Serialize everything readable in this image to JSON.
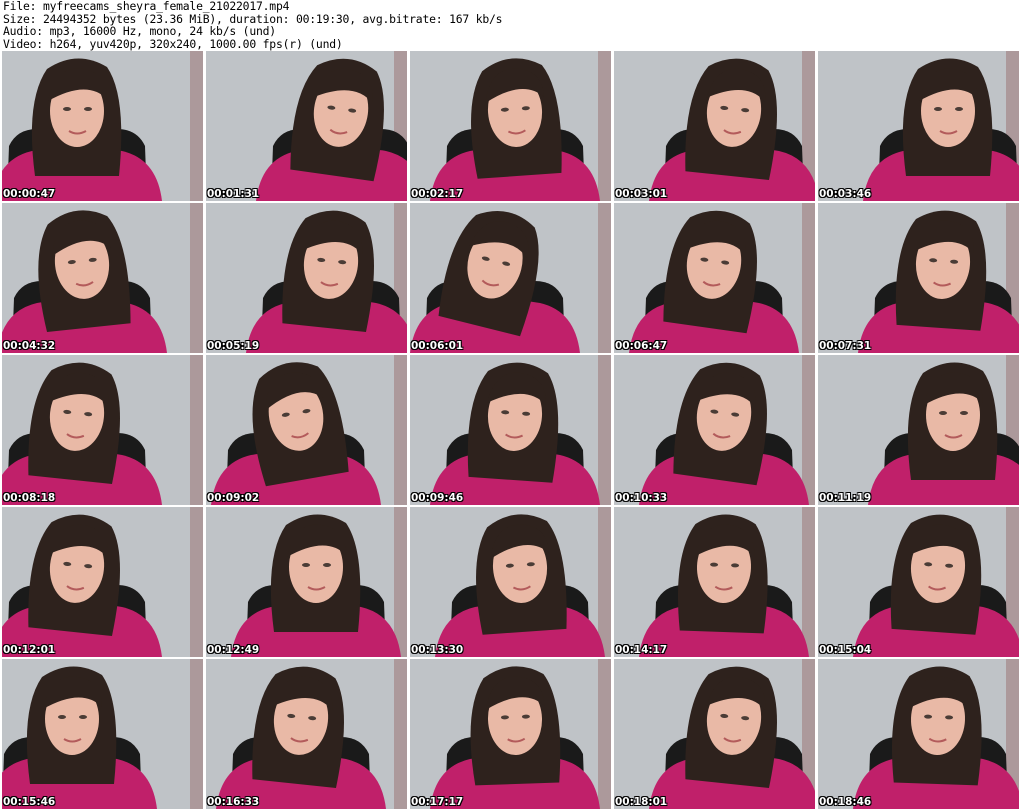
{
  "header": {
    "file_line": "File: myfreecams_sheyra_female_21022017.mp4",
    "size_line": "Size: 24494352 bytes (23.36 MiB), duration: 00:19:30, avg.bitrate: 167 kb/s",
    "audio_line": "Audio: mp3, 16000 Hz, mono, 24 kb/s (und)",
    "video_line": "Video: h264, yuv420p, 320x240, 1000.00 fps(r) (und)"
  },
  "frames": [
    {
      "ts": "00:00:47"
    },
    {
      "ts": "00:01:31"
    },
    {
      "ts": "00:02:17"
    },
    {
      "ts": "00:03:01"
    },
    {
      "ts": "00:03:46"
    },
    {
      "ts": "00:04:32"
    },
    {
      "ts": "00:05:19"
    },
    {
      "ts": "00:06:01"
    },
    {
      "ts": "00:06:47"
    },
    {
      "ts": "00:07:31"
    },
    {
      "ts": "00:08:18"
    },
    {
      "ts": "00:09:02"
    },
    {
      "ts": "00:09:46"
    },
    {
      "ts": "00:10:33"
    },
    {
      "ts": "00:11:19"
    },
    {
      "ts": "00:12:01"
    },
    {
      "ts": "00:12:49"
    },
    {
      "ts": "00:13:30"
    },
    {
      "ts": "00:14:17"
    },
    {
      "ts": "00:15:04"
    },
    {
      "ts": "00:15:46"
    },
    {
      "ts": "00:16:33"
    },
    {
      "ts": "00:17:17"
    },
    {
      "ts": "00:18:01"
    },
    {
      "ts": "00:18:46"
    }
  ],
  "colors": {
    "background_wall": "#bfc3c7",
    "sweater": "#c0206a",
    "hair": "#2e221d",
    "skin": "#e9b9a6",
    "chair": "#1a1a1a"
  }
}
